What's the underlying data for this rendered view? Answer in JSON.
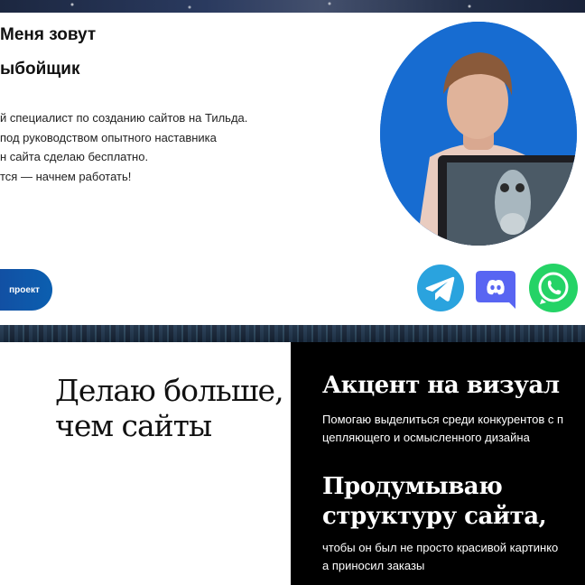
{
  "hero": {
    "title_lines": [
      "Меня зовут",
      "ыбойщик"
    ],
    "description_lines": [
      "й специалист по созданию сайтов на Тильда.",
      "под руководством опытного наставника",
      "н сайта сделаю бесплатно.",
      "тся — начнем работать!"
    ],
    "cta_label": "проект"
  },
  "social": {
    "telegram_icon": "telegram-icon",
    "discord_icon": "discord-icon",
    "whatsapp_icon": "whatsapp-icon",
    "colors": {
      "telegram": "#2aa3de",
      "discord": "#5865f2",
      "whatsapp": "#25d366"
    }
  },
  "intro": {
    "heading_lines": [
      "Делаю больше,",
      "чем сайты"
    ]
  },
  "features": [
    {
      "title_lines": [
        "Акцент на визуал"
      ],
      "text_lines": [
        "Помогаю выделиться среди конкурентов с п",
        "цепляющего и осмысленного дизайна"
      ]
    },
    {
      "title_lines": [
        "Продумываю",
        "структуру сайта,"
      ],
      "text_lines": [
        "чтобы он был не просто красивой картинко",
        "а приносил заказы"
      ]
    }
  ],
  "colors": {
    "accent_blue": "#0b5fb0",
    "avatar_bg": "#1670d9"
  }
}
